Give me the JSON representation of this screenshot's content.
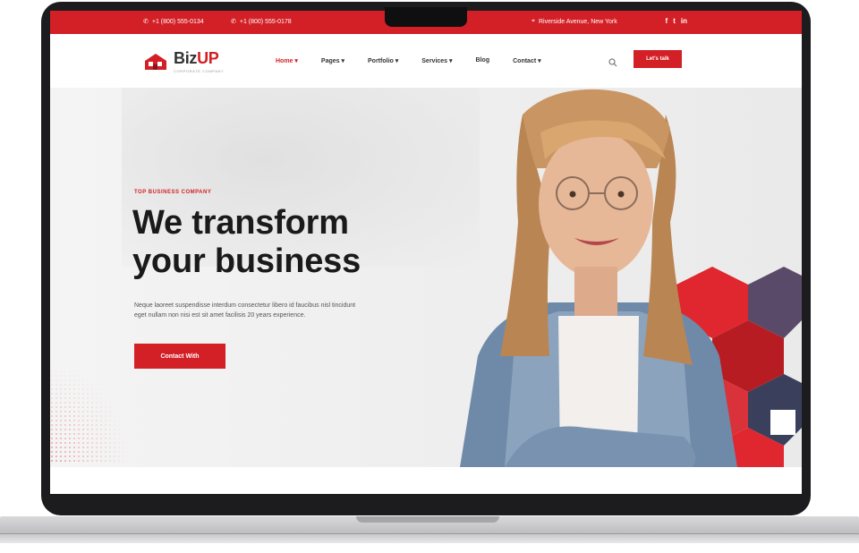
{
  "topbar": {
    "phone_1": "+1 (800) 555-0134",
    "phone_2": "+1 (800) 555-0178",
    "address": "Riverside Avenue, New York",
    "social": [
      "f",
      "t",
      "in"
    ]
  },
  "brand": {
    "name_main": "Biz",
    "name_accent": "UP",
    "tagline": "CORPORATE COMPANY"
  },
  "nav": {
    "items": [
      {
        "label": "Home",
        "active": true
      },
      {
        "label": "Pages",
        "active": false
      },
      {
        "label": "Portfolio",
        "active": false
      },
      {
        "label": "Services",
        "active": false
      },
      {
        "label": "Blog",
        "active": false
      },
      {
        "label": "Contact",
        "active": false
      }
    ],
    "cta_label": "Let's talk"
  },
  "hero": {
    "eyebrow": "TOP BUSINESS COMPANY",
    "headline_line1": "We transform",
    "headline_line2": "your business",
    "description": "Neque laoreet suspendisse interdum consectetur libero id faucibus nisl tincidunt eget nullam non nisi est sit amet facilisis 20 years experience.",
    "cta_label": "Contact With"
  },
  "colors": {
    "accent": "#d31f26",
    "dark_text": "#1a1a1a",
    "bezel": "#1c1c1f"
  }
}
